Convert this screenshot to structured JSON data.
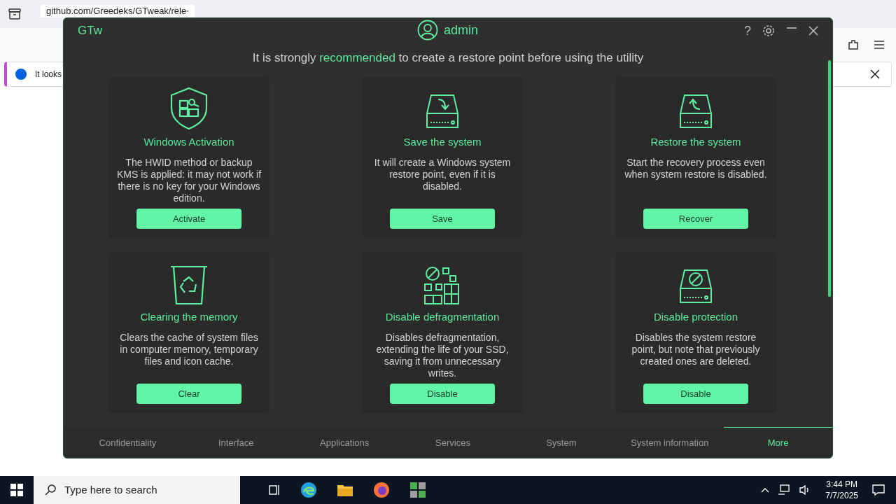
{
  "browser": {
    "tab_title": "github.com/Greedeks/GTweak/rele",
    "notification": "It looks"
  },
  "app": {
    "logo": "GTw",
    "user": "admin",
    "help": "?",
    "banner": {
      "before": "It is strongly ",
      "highlight": "recommended",
      "after": " to create a restore point before using the utility"
    },
    "cards": [
      {
        "kind": "shield",
        "title": "Windows Activation",
        "description": "The HWID method or backup KMS is applied: it may not work if there is no key for your Windows edition.",
        "button": "Activate"
      },
      {
        "kind": "drive-in",
        "title": "Save the system",
        "description": "It will create a Windows system restore point, even if it is disabled.",
        "button": "Save"
      },
      {
        "kind": "drive-out",
        "title": "Restore the system",
        "description": "Start the recovery process even when system restore is disabled.",
        "button": "Recover"
      },
      {
        "kind": "bin",
        "title": "Clearing the memory",
        "description": "Clears the cache of system files in computer memory, temporary files and icon cache.",
        "button": "Clear"
      },
      {
        "kind": "grid",
        "title": "Disable defragmentation",
        "description": "Disables defragmentation, extending the life of your SSD, saving it from unnecessary writes.",
        "button": "Disable"
      },
      {
        "kind": "drive-blocked",
        "title": "Disable protection",
        "description": "Disables the system restore point, but note that previously created ones are deleted.",
        "button": "Disable"
      }
    ],
    "nav": [
      {
        "label": "Confidentiality",
        "selected": false
      },
      {
        "label": "Interface",
        "selected": false
      },
      {
        "label": "Applications",
        "selected": false
      },
      {
        "label": "Services",
        "selected": false
      },
      {
        "label": "System",
        "selected": false
      },
      {
        "label": "System information",
        "selected": false
      },
      {
        "label": "More",
        "selected": true
      }
    ]
  },
  "taskbar": {
    "search_placeholder": "Type here to search",
    "time": "3:44 PM",
    "date": "7/7/2025"
  }
}
